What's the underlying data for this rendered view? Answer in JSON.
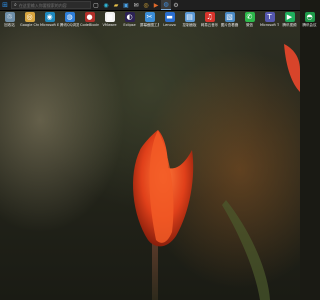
{
  "taskbar": {
    "search_placeholder": "在这里输入你要搜索的内容",
    "apps": [
      {
        "icon": "task-view-icon",
        "glyph": "▢",
        "color": "#dddddd"
      },
      {
        "icon": "edge-icon",
        "glyph": "◉",
        "color": "#2fb5d8"
      },
      {
        "icon": "file-explorer-icon",
        "glyph": "▰",
        "color": "#e8c04a"
      },
      {
        "icon": "store-icon",
        "glyph": "▣",
        "color": "#4aa3e8"
      },
      {
        "icon": "mail-icon",
        "glyph": "✉",
        "color": "#cfcfcf"
      },
      {
        "icon": "chrome-icon",
        "glyph": "◎",
        "color": "#e9b43a"
      },
      {
        "icon": "media-player-icon",
        "glyph": "▶",
        "color": "#e06a2b"
      },
      {
        "icon": "browser-icon",
        "glyph": "◍",
        "color": "#3f8fe0"
      },
      {
        "icon": "settings-icon",
        "glyph": "⚙",
        "color": "#bbbbbb"
      }
    ]
  },
  "desktop_icons": [
    {
      "label": "回收站",
      "icon": "recycle-bin-icon",
      "glyph": "♲",
      "bg": "#6f8fa8"
    },
    {
      "label": "Google Chrome",
      "icon": "chrome-icon",
      "glyph": "◎",
      "bg": "#d9a640"
    },
    {
      "label": "Microsoft Edge",
      "icon": "edge-icon",
      "glyph": "◉",
      "bg": "#1f8ac0"
    },
    {
      "label": "腾讯QQ浏览器",
      "icon": "qq-browser-icon",
      "glyph": "◍",
      "bg": "#2e7fd8"
    },
    {
      "label": "CodeBlocks",
      "icon": "codeblocks-icon",
      "glyph": "●",
      "bg": "#b3302a"
    },
    {
      "label": "VMware",
      "icon": "vmware-icon",
      "glyph": "▦",
      "bg": "#f0f0f0"
    },
    {
      "label": "Eclipse",
      "icon": "eclipse-icon",
      "glyph": "◐",
      "bg": "#2c2255"
    },
    {
      "label": "屏幕截图工具",
      "icon": "snipping-tool-icon",
      "glyph": "✂",
      "bg": "#3c8ed8"
    },
    {
      "label": "Lenovo",
      "icon": "lenovo-icon",
      "glyph": "▬",
      "bg": "#2a6fd0"
    },
    {
      "label": "控制面板",
      "icon": "control-panel-icon",
      "glyph": "▤",
      "bg": "#5c9ad6"
    },
    {
      "label": "网易云音乐",
      "icon": "netease-music-icon",
      "glyph": "♫",
      "bg": "#d8342c"
    },
    {
      "label": "图片查看器",
      "icon": "photo-viewer-icon",
      "glyph": "▧",
      "bg": "#4a8ac4"
    },
    {
      "label": "微信",
      "icon": "wechat-icon",
      "glyph": "✆",
      "bg": "#2db84b"
    },
    {
      "label": "Microsoft Teams",
      "icon": "teams-icon",
      "glyph": "T",
      "bg": "#5558af"
    },
    {
      "label": "腾讯视频",
      "icon": "tencent-video-icon",
      "glyph": "▶",
      "bg": "#1fae5c"
    },
    {
      "label": "腾讯会议",
      "icon": "tencent-meeting-icon",
      "glyph": "◓",
      "bg": "#1f9a4a"
    }
  ]
}
